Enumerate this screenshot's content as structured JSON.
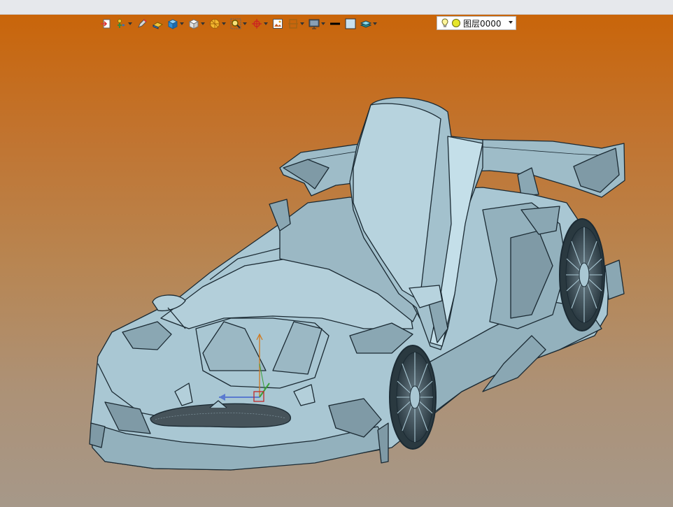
{
  "window": {
    "background_top": "#c9650a",
    "background_bottom": "#a69889",
    "model_color": "#a9c7d3",
    "edge_color": "#1b2a33"
  },
  "toolbar": {
    "items": [
      {
        "name": "exit-sketch-icon",
        "dropdown": false
      },
      {
        "name": "select-filter-icon",
        "dropdown": true
      },
      {
        "name": "pencil-icon",
        "dropdown": false
      },
      {
        "name": "eraser-icon",
        "dropdown": false
      },
      {
        "name": "solid-box-icon",
        "dropdown": true
      },
      {
        "name": "view-cube-icon",
        "dropdown": true
      },
      {
        "name": "render-style-icon",
        "dropdown": true
      },
      {
        "name": "zoom-icon",
        "dropdown": true
      },
      {
        "name": "origin-icon",
        "dropdown": true
      },
      {
        "name": "snapshot-icon",
        "dropdown": false
      },
      {
        "name": "section-icon",
        "dropdown": true
      },
      {
        "name": "display-icon",
        "dropdown": true
      },
      {
        "name": "line-color-icon",
        "dropdown": false
      },
      {
        "name": "fill-color-icon",
        "dropdown": false
      },
      {
        "name": "layer-stack-icon",
        "dropdown": true
      }
    ],
    "layer_select": {
      "value": "图层0000",
      "visible_icon": "lightbulb-icon",
      "color_icon": "layer-color-dot-icon"
    }
  }
}
